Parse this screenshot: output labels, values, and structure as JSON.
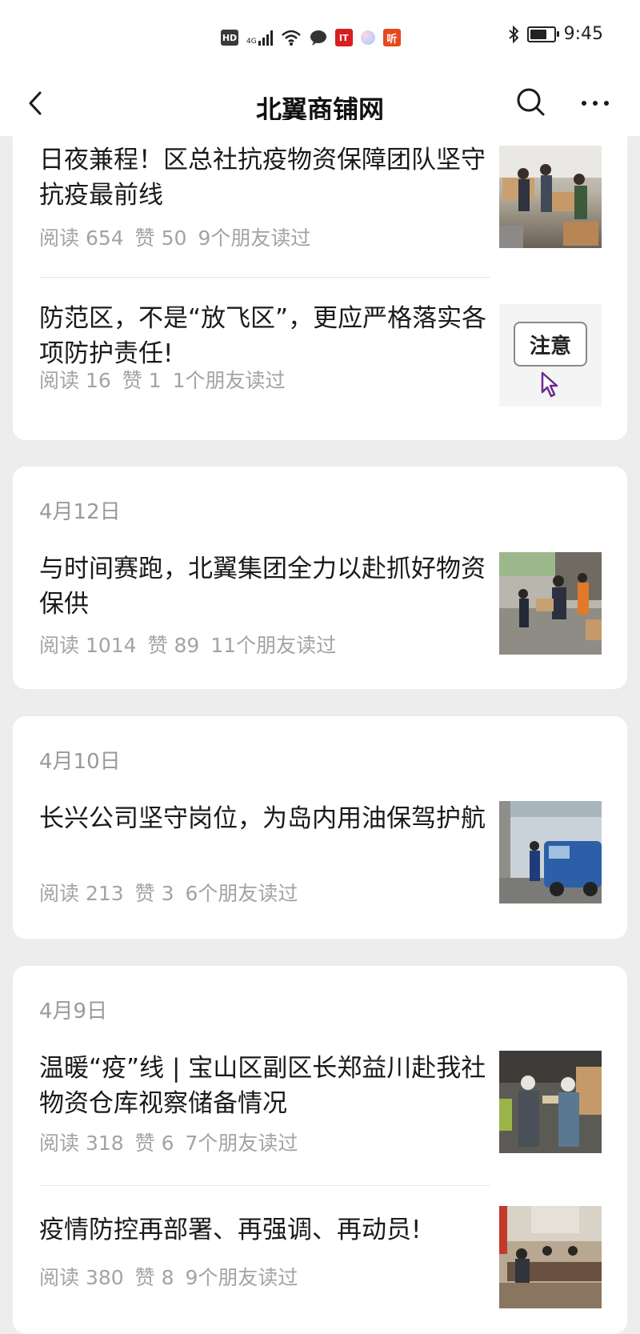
{
  "status_bar": {
    "time": "9:45",
    "network": "4G",
    "icons": [
      "hd-icon",
      "signal-icon",
      "wifi-icon",
      "chat-bubble-icon",
      "it-app-icon",
      "circle-app-icon",
      "listen-app-icon",
      "bluetooth-icon",
      "battery-icon"
    ],
    "app_badge_1": "IT",
    "app_badge_2": "听"
  },
  "nav": {
    "title": "北翼商铺网",
    "icons": [
      "back-arrow-icon",
      "search-icon",
      "more-icon"
    ]
  },
  "sections": [
    {
      "date": "",
      "articles": [
        {
          "title": "日夜兼程！区总社抗疫物资保障团队坚守抗疫最前线",
          "read": "阅读 654",
          "likes": "赞 50",
          "friends": "9个朋友读过"
        },
        {
          "title": "防范区，不是“放飞区”，更应严格落实各项防护责任!",
          "read": "阅读 16",
          "likes": "赞 1",
          "friends": "1个朋友读过",
          "thumb_text": "注意"
        }
      ]
    },
    {
      "date": "4月12日",
      "articles": [
        {
          "title": "与时间赛跑，北翼集团全力以赴抓好物资保供",
          "read": "阅读 1014",
          "likes": "赞 89",
          "friends": "11个朋友读过"
        }
      ]
    },
    {
      "date": "4月10日",
      "articles": [
        {
          "title": "长兴公司坚守岗位，为岛内用油保驾护航",
          "read": "阅读 213",
          "likes": "赞 3",
          "friends": "6个朋友读过"
        }
      ]
    },
    {
      "date": "4月9日",
      "articles": [
        {
          "title": "温暖“疫”线 | 宝山区副区长郑益川赴我社物资仓库视察储备情况",
          "read": "阅读 318",
          "likes": "赞 6",
          "friends": "7个朋友读过"
        },
        {
          "title": "疫情防控再部署、再强调、再动员!",
          "read": "阅读 380",
          "likes": "赞 8",
          "friends": "9个朋友读过"
        }
      ]
    }
  ]
}
